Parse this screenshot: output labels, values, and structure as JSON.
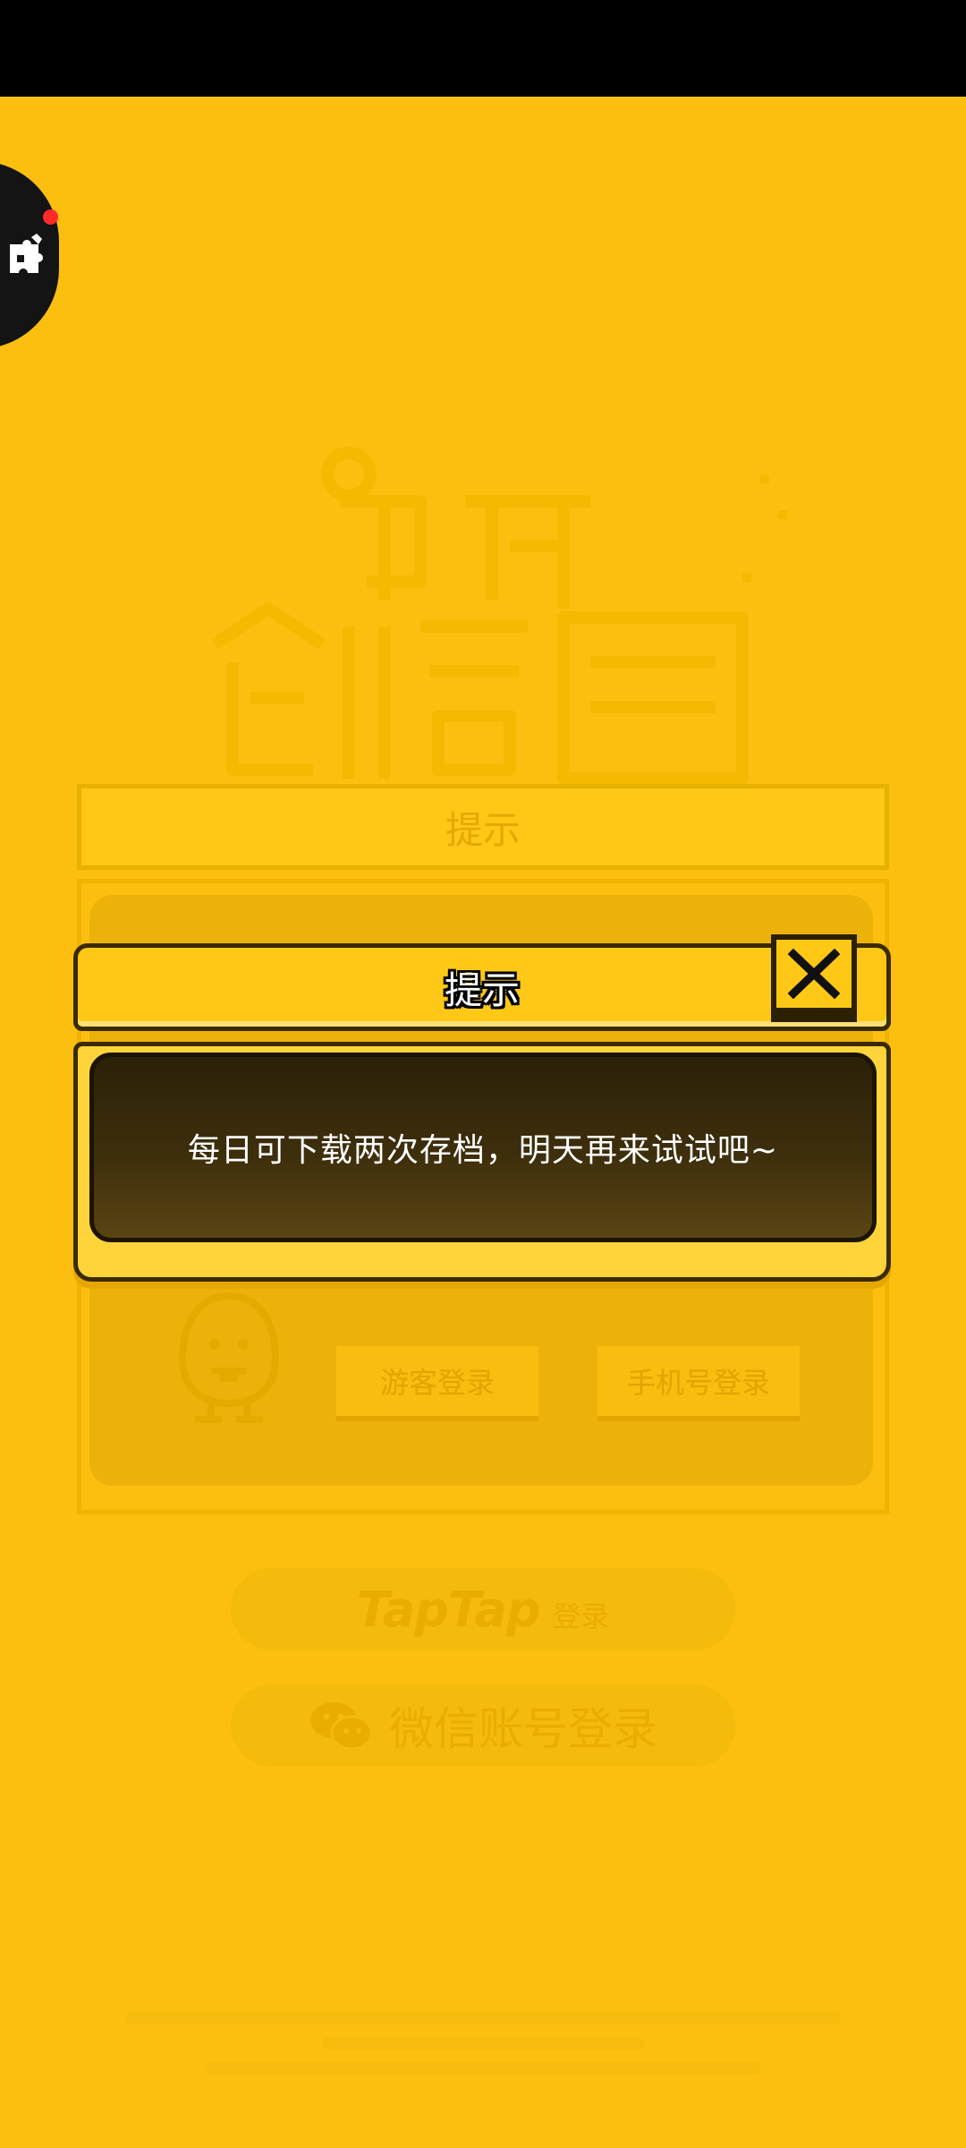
{
  "status_bar": {},
  "side_tool": {
    "icon": "puzzle-icon",
    "badge_color": "#ff2a2a"
  },
  "background": {
    "panel_title": "提示",
    "guest_login": "游客登录",
    "phone_login": "手机号登录",
    "taptap_word": "TapTap",
    "taptap_login": "登录",
    "wechat_login": "微信账号登录"
  },
  "dialog": {
    "title": "提示",
    "message": "每日可下载两次存档，明天再来试试吧~",
    "close_icon": "close-icon"
  },
  "colors": {
    "background": "#fcbf10",
    "dialog_header": "#ffc816",
    "message_box": "#3e2f0c",
    "badge": "#ff2a2a"
  }
}
